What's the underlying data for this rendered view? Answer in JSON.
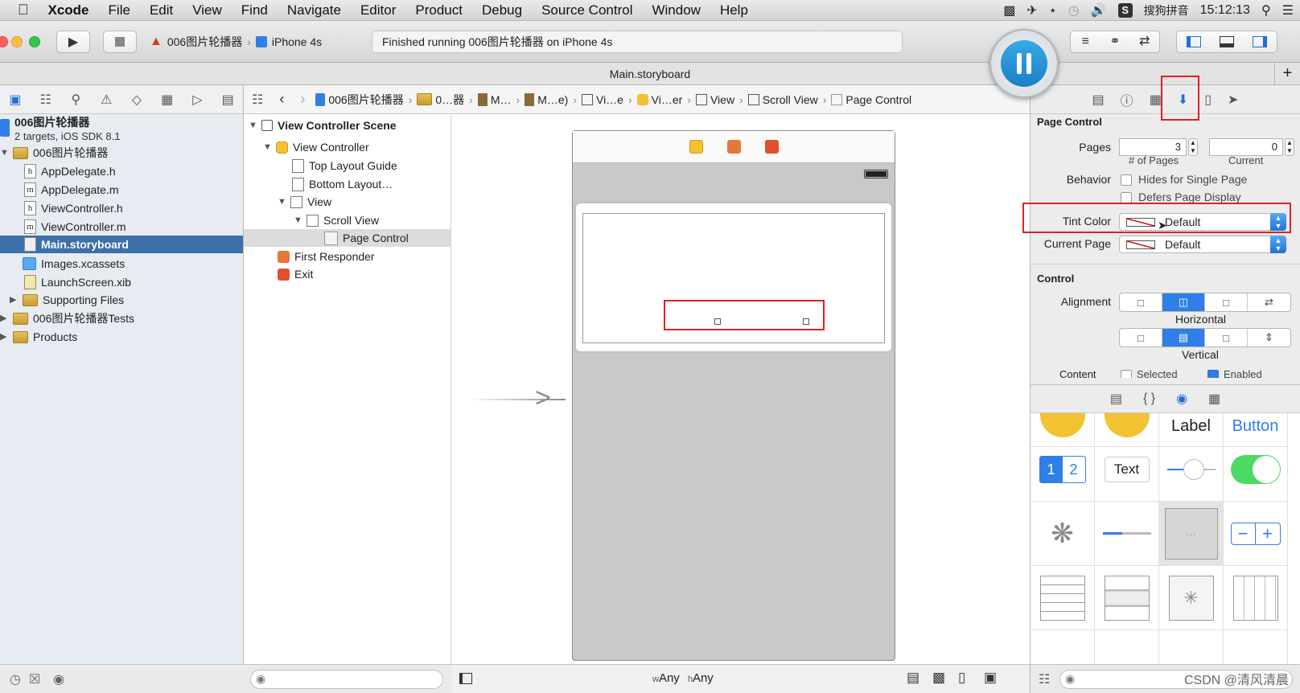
{
  "menubar": {
    "apple": "",
    "app": "Xcode",
    "items": [
      "File",
      "Edit",
      "View",
      "Find",
      "Navigate",
      "Editor",
      "Product",
      "Debug",
      "Source Control",
      "Window",
      "Help"
    ],
    "ime": "搜狗拼音",
    "clock": "15:12:13"
  },
  "toolbar": {
    "scheme_project": "006图片轮播器",
    "scheme_device": "iPhone 4s",
    "status": "Finished running 006图片轮播器 on iPhone 4s"
  },
  "tabbar": {
    "title": "Main.storyboard"
  },
  "navigator": {
    "project": {
      "name": "006图片轮播器",
      "subtitle": "2 targets, iOS SDK 8.1"
    },
    "items": [
      {
        "label": "006图片轮播器",
        "type": "folder"
      },
      {
        "label": "AppDelegate.h",
        "type": "h"
      },
      {
        "label": "AppDelegate.m",
        "type": "m"
      },
      {
        "label": "ViewController.h",
        "type": "h"
      },
      {
        "label": "ViewController.m",
        "type": "m"
      },
      {
        "label": "Main.storyboard",
        "type": "sb"
      },
      {
        "label": "Images.xcassets",
        "type": "assets"
      },
      {
        "label": "LaunchScreen.xib",
        "type": "xib"
      },
      {
        "label": "Supporting Files",
        "type": "folder"
      },
      {
        "label": "006图片轮播器Tests",
        "type": "folder"
      },
      {
        "label": "Products",
        "type": "folder"
      }
    ]
  },
  "jumpbar": [
    "006图片轮播器",
    "0…器",
    "M…",
    "M…e)",
    "Vi…e",
    "Vi…er",
    "View",
    "Scroll View",
    "Page Control"
  ],
  "outline": {
    "scene": "View Controller Scene",
    "items": [
      "View Controller",
      "Top Layout Guide",
      "Bottom Layout…",
      "View",
      "Scroll View",
      "Page Control",
      "First Responder",
      "Exit"
    ]
  },
  "canvas": {
    "size_w": "Any",
    "size_h": "Any",
    "w_prefix": "w",
    "h_prefix": "h"
  },
  "inspector": {
    "section_page_control": "Page Control",
    "pages_label": "Pages",
    "pages_value": "3",
    "pages_sub": "# of Pages",
    "current_value": "0",
    "current_sub": "Current",
    "behavior_label": "Behavior",
    "hides_label": "Hides for Single Page",
    "defers_label": "Defers Page Display",
    "tint_label": "Tint Color",
    "tint_value": "Default",
    "current_page_label": "Current Page",
    "current_page_value": "Default",
    "section_control": "Control",
    "alignment_label": "Alignment",
    "horizontal_label": "Horizontal",
    "vertical_label": "Vertical",
    "content_label": "Content",
    "selected_label": "Selected",
    "enabled_label": "Enabled"
  },
  "library": {
    "label_text": "Label",
    "button_text": "Button",
    "seg_1": "1",
    "seg_2": "2",
    "text_field": "Text",
    "stepper_minus": "−",
    "stepper_plus": "+"
  },
  "watermark": "CSDN @清风清晨",
  "colors": {
    "accent": "#2f7fe6",
    "highlight_box": "#e02020",
    "selection": "#3d6fa8"
  }
}
